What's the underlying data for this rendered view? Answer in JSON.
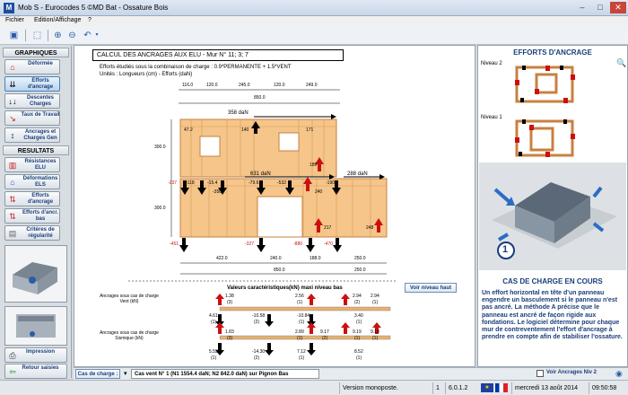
{
  "window": {
    "title": "Mob S - Eurocodes 5 ©MD Bat - Ossature  Bois",
    "min": "–",
    "max": "□",
    "close": "✕"
  },
  "menu": [
    "Fichier",
    "Edition/Affichage",
    "?"
  ],
  "sidebar": {
    "graphiques": "GRAPHIQUES",
    "resultats": "RESULTATS",
    "buttons": [
      {
        "label": "Déformée"
      },
      {
        "label": "Efforts d'ancrage"
      },
      {
        "label": "Descentes Charges"
      },
      {
        "label": "Taux de Travail"
      },
      {
        "label": "Ancrages et Charges Gen"
      },
      {
        "label": "Résistances ELU"
      },
      {
        "label": "Déformations ELS"
      },
      {
        "label": "Efforts d'ancrage"
      },
      {
        "label": "Efforts d'ancr. bas"
      },
      {
        "label": "Critères de régularité"
      }
    ],
    "impression": "Impression",
    "retour": "Retour saisies"
  },
  "drawing": {
    "title": "CALCUL DES ANCRAGES AUX ELU - Mur N° 11; 3; 7",
    "combo": "Efforts étudiés sous la combinaison de charge : 0.9*PERMANENTE + 1.5*VENT",
    "units": "Unités : Longueurs (cm) - Efforts (daN)",
    "top_dims": [
      "116.0",
      "120.0",
      "245.0",
      "120.0",
      "249.0"
    ],
    "top_total": "850.0",
    "bottom_dims": [
      "422.0",
      "240.0",
      "188.0",
      "250.0"
    ],
    "bottom_total1": "850.0",
    "bottom_total2": "250.0",
    "heights": [
      "300.0",
      "300.0"
    ],
    "upper_load": "358 daN",
    "mid_load": "631 daN",
    "right_load": "288 daN",
    "upper_vals": [
      "47.2",
      "140",
      "171",
      "189"
    ],
    "mid_vals": [
      "-237",
      "-118",
      "-15.4",
      "-79.6",
      "-532",
      "240",
      "-190",
      "-350",
      "217",
      "248"
    ],
    "base_vals": [
      "-451",
      "-327",
      "-880",
      "-470"
    ],
    "section_title": "Valeurs caractéristiques(kN) maxi niveau bas",
    "voir_haut": "Voir niveau haut",
    "vent_label": "Ancrages sous cas de charge Vent (kN)",
    "seismic_label": "Ancrages sous cas de charge Sismique (kN)",
    "vent_vals": [
      "1.38",
      "(3)",
      "4.61",
      "(1)",
      "-10.58",
      "(2)",
      "2.56",
      "(1)",
      "-10.84",
      "(1)",
      "2.94",
      "(2)",
      "3.40",
      "(1)",
      "2.94",
      "(1)"
    ],
    "seis_vals": [
      "1.83",
      "(3)",
      "5.53",
      "(1)",
      "-14.30",
      "(2)",
      "2.89",
      "(1)",
      "9.17",
      "(2)",
      "7.12",
      "(1)",
      "9.19",
      "(1)",
      "8.52",
      "(1)",
      "9.19",
      "(1)"
    ]
  },
  "right": {
    "title": "EFFORTS D'ANCRAGE",
    "niveau2": "Niveau 2",
    "niveau1": "Niveau 1",
    "cas_title": "CAS DE CHARGE EN COURS",
    "cas_badge": "1",
    "description": "Un effort horizontal en tête d'un panneau engendre un basculement si le panneau n'est pas ancré. La méthode A précise que le panneau est ancré de façon rigide aux fondations. Le logiciel détermine pour chaque mur de contreventement l'effort d'ancrage à prendre en compte afin de stabiliser l'ossature."
  },
  "bottom": {
    "cas_label": "Cas de charge :",
    "cas_value": "Cas vent N° 1 (N1 1554.4 daN; N2 842.0 daN) sur Pignon Bas",
    "voir_ancrages": "Voir Ancrages Niv 2"
  },
  "status": {
    "version": "Version monoposte.",
    "index": "1",
    "build": "6.0.1.2",
    "date": "mercredi 13 août 2014",
    "time": "09:50:58"
  },
  "colors": {
    "wood": "#f5c58a",
    "wood_edge": "#c88040",
    "red_arrow": "#cc1010",
    "accent": "#1a3e7a"
  }
}
